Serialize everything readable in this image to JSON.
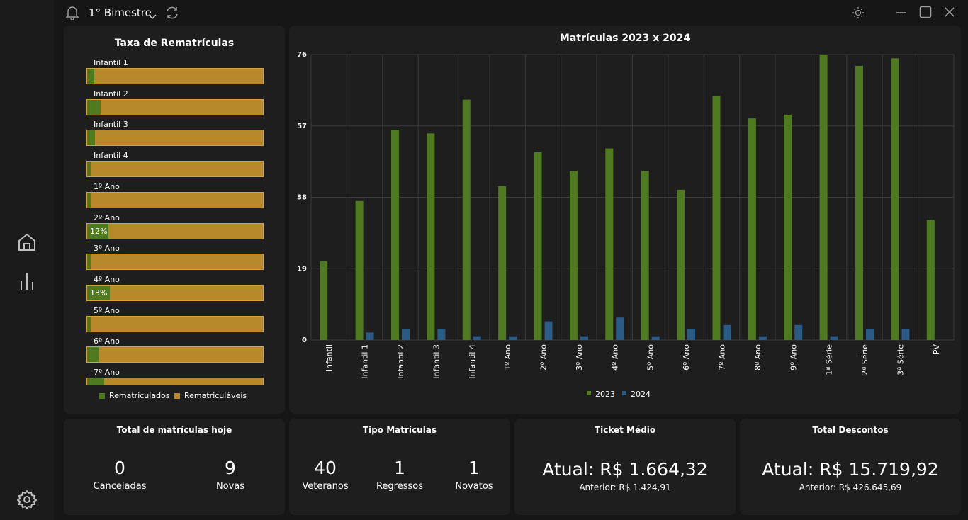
{
  "topbar": {
    "period": "1° Bimestre",
    "icons": [
      "bell-icon",
      "chevron-down-icon",
      "refresh-icon",
      "sun-icon",
      "minimize-icon",
      "maximize-icon",
      "close-icon"
    ]
  },
  "nav": {
    "icons": [
      "home-icon",
      "bar-chart-icon",
      "settings-icon"
    ]
  },
  "rematriculas": {
    "title": "Taxa de Rematrículas",
    "rows": [
      {
        "label": "Infantil 1",
        "fraction": 0.04,
        "pct": ""
      },
      {
        "label": "Infantil 2",
        "fraction": 0.075,
        "pct": ""
      },
      {
        "label": "Infantil 3",
        "fraction": 0.045,
        "pct": ""
      },
      {
        "label": "Infantil 4",
        "fraction": 0.02,
        "pct": ""
      },
      {
        "label": "1º Ano",
        "fraction": 0.02,
        "pct": ""
      },
      {
        "label": "2º Ano",
        "fraction": 0.12,
        "pct": "12%"
      },
      {
        "label": "3º Ano",
        "fraction": 0.02,
        "pct": ""
      },
      {
        "label": "4º Ano",
        "fraction": 0.13,
        "pct": "13%"
      },
      {
        "label": "5º Ano",
        "fraction": 0.02,
        "pct": ""
      },
      {
        "label": "6º Ano",
        "fraction": 0.065,
        "pct": ""
      },
      {
        "label": "7º Ano",
        "fraction": 0.095,
        "pct": ""
      }
    ],
    "legend": [
      {
        "label": "Rematriculados",
        "color": "#4f7a1f"
      },
      {
        "label": "Rematriculáveis",
        "color": "#b8892b"
      }
    ]
  },
  "chart_data": {
    "type": "bar",
    "title": "Matrículas 2023 x 2024",
    "categories": [
      "Infantil",
      "Infantil 1",
      "Infantil 2",
      "Infantil 3",
      "Infantil 4",
      "1º Ano",
      "2º Ano",
      "3º Ano",
      "4º Ano",
      "5º Ano",
      "6º Ano",
      "7º Ano",
      "8º Ano",
      "9º Ano",
      "1ª Série",
      "2ª Série",
      "3ª Série",
      "PV"
    ],
    "series": [
      {
        "name": "2023",
        "color": "#4f7a1f",
        "values": [
          21,
          37,
          56,
          55,
          64,
          41,
          50,
          45,
          51,
          45,
          40,
          65,
          59,
          60,
          76,
          73,
          75,
          32
        ]
      },
      {
        "name": "2024",
        "color": "#2a5a86",
        "values": [
          0,
          2,
          3,
          3,
          1,
          1,
          5,
          1,
          6,
          1,
          3,
          4,
          1,
          4,
          1,
          3,
          3,
          0
        ]
      }
    ],
    "yticks": [
      "0",
      "19",
      "38",
      "57",
      "76"
    ],
    "ylim": [
      0,
      76
    ],
    "grid": true,
    "legend": "bottom"
  },
  "total_hoje": {
    "title": "Total de matrículas hoje",
    "items": [
      {
        "value": "0",
        "label": "Canceladas"
      },
      {
        "value": "9",
        "label": "Novas"
      }
    ]
  },
  "tipo": {
    "title": "Tipo Matrículas",
    "items": [
      {
        "value": "40",
        "label": "Veteranos"
      },
      {
        "value": "1",
        "label": "Regressos"
      },
      {
        "value": "1",
        "label": "Novatos"
      }
    ]
  },
  "ticket": {
    "title": "Ticket Médio",
    "current": "Atual: R$ 1.664,32",
    "previous": "Anterior: R$ 1.424,91"
  },
  "descontos": {
    "title": "Total Descontos",
    "current": "Atual: R$ 15.719,92",
    "previous": "Anterior: R$ 426.645,69"
  }
}
